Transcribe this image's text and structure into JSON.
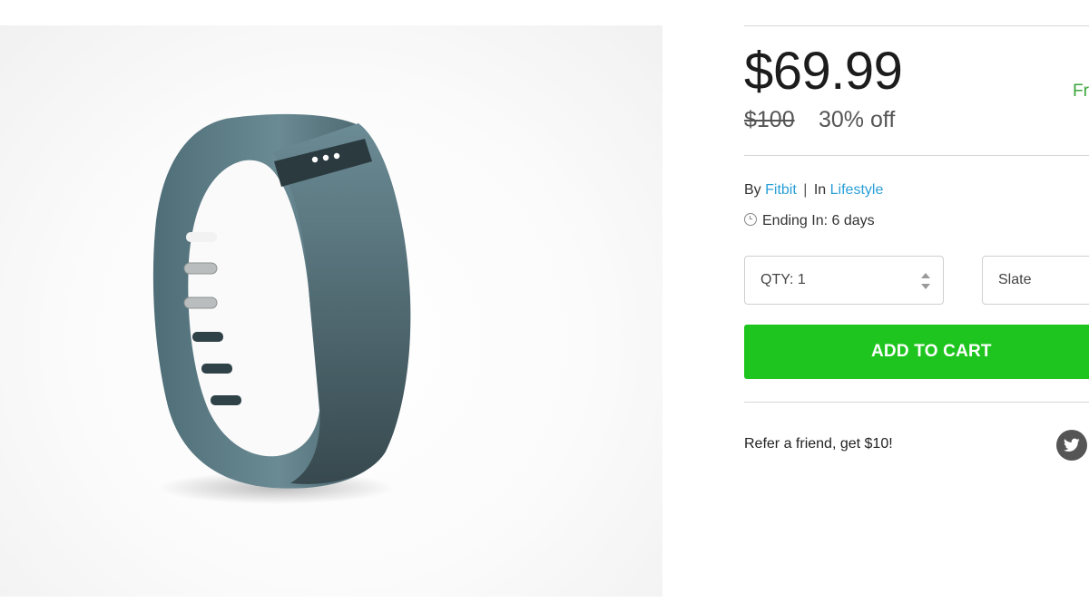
{
  "product": {
    "price": "$69.99",
    "free_label": "Fr",
    "original_price": "$100",
    "discount": "30% off",
    "by_label": "By",
    "brand": "Fitbit",
    "separator": "|",
    "in_label": "In",
    "category": "Lifestyle",
    "ending": "Ending In: 6 days"
  },
  "controls": {
    "quantity": "QTY: 1",
    "color_option": "Slate",
    "add_to_cart": "ADD TO CART"
  },
  "referral": {
    "text": "Refer a friend, get $10!"
  },
  "icons": {
    "clock": "clock-icon",
    "stepper": "chevron-updown-icon",
    "twitter": "twitter-icon"
  },
  "colors": {
    "price_text": "#1c1c1c",
    "free_shipping": "#3aa53a",
    "link": "#2a9fd8",
    "cart_button": "#1ec51e",
    "band": "#5b7c85"
  }
}
